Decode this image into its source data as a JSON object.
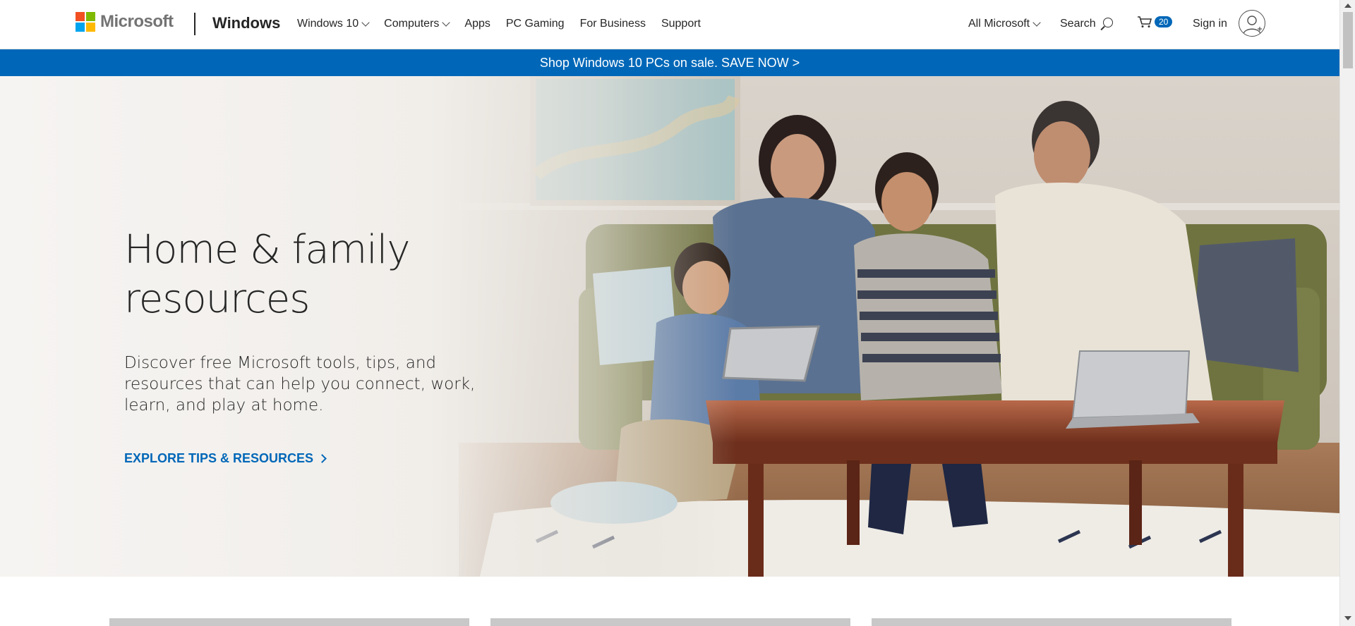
{
  "header": {
    "logo_text": "Microsoft",
    "brand": "Windows",
    "nav": [
      {
        "label": "Windows 10",
        "dropdown": true
      },
      {
        "label": "Computers",
        "dropdown": true
      },
      {
        "label": "Apps",
        "dropdown": false
      },
      {
        "label": "PC Gaming",
        "dropdown": false
      },
      {
        "label": "For Business",
        "dropdown": false
      },
      {
        "label": "Support",
        "dropdown": false
      }
    ],
    "all_microsoft": "All Microsoft",
    "search": "Search",
    "cart_count": "20",
    "sign_in": "Sign in"
  },
  "promo": {
    "text": "Shop Windows 10 PCs on sale. SAVE NOW >"
  },
  "hero": {
    "title_line1": "Home & family",
    "title_line2": "resources",
    "description": "Discover free Microsoft tools, tips, and resources that can help you connect, work, learn, and play at home.",
    "cta": "EXPLORE TIPS & RESOURCES"
  },
  "colors": {
    "accent": "#0067b8",
    "logo_red": "#f25022",
    "logo_green": "#7fba00",
    "logo_blue": "#00a4ef",
    "logo_yellow": "#ffb900"
  },
  "icons": [
    "microsoft-logo-icon",
    "chevron-down-icon",
    "search-icon",
    "cart-icon",
    "account-icon",
    "chevron-right-icon"
  ]
}
